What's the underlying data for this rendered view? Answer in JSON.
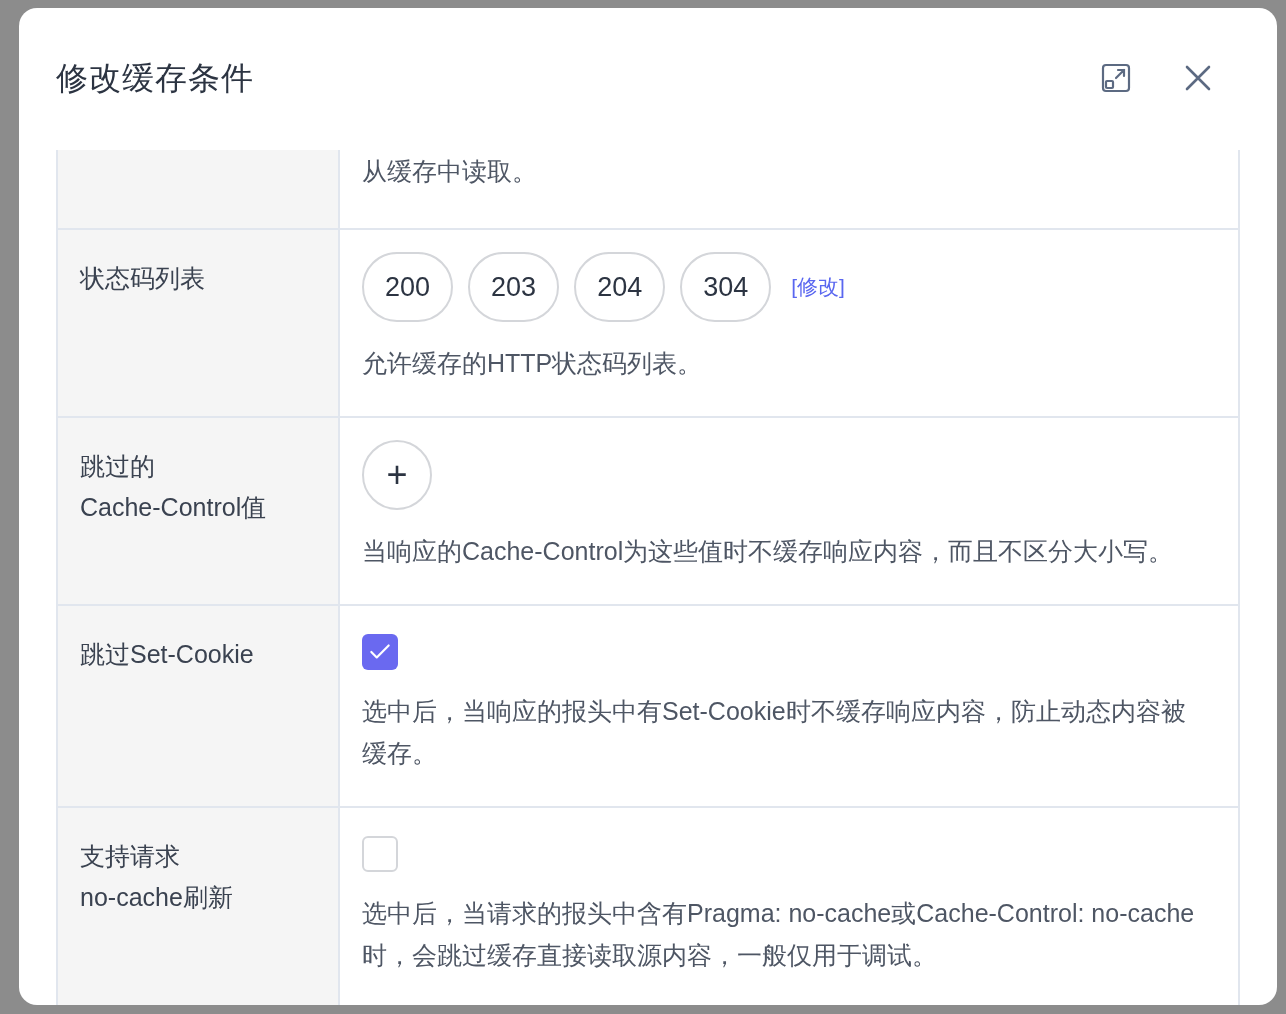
{
  "dialog": {
    "title": "修改缓存条件"
  },
  "rows": [
    {
      "kind": "text",
      "description": "从缓存中读取。"
    },
    {
      "kind": "tags",
      "label": "状态码列表",
      "tags": [
        "200",
        "203",
        "204",
        "304"
      ],
      "edit_link": "[修改]",
      "description": "允许缓存的HTTP状态码列表。"
    },
    {
      "kind": "add",
      "label": "跳过的\nCache-Control值",
      "add_symbol": "+",
      "description": "当响应的Cache-Control为这些值时不缓存响应内容，而且不区分大小写。"
    },
    {
      "kind": "checkbox",
      "label": "跳过Set-Cookie",
      "checked": true,
      "description": "选中后，当响应的报头中有Set-Cookie时不缓存响应内容，防止动态内容被缓存。"
    },
    {
      "kind": "checkbox",
      "label": "支持请求\nno-cache刷新",
      "checked": false,
      "description": "选中后，当请求的报头中含有Pragma: no-cache或Cache-Control: no-cache时，会跳过缓存直接读取源内容，一般仅用于调试。"
    }
  ]
}
